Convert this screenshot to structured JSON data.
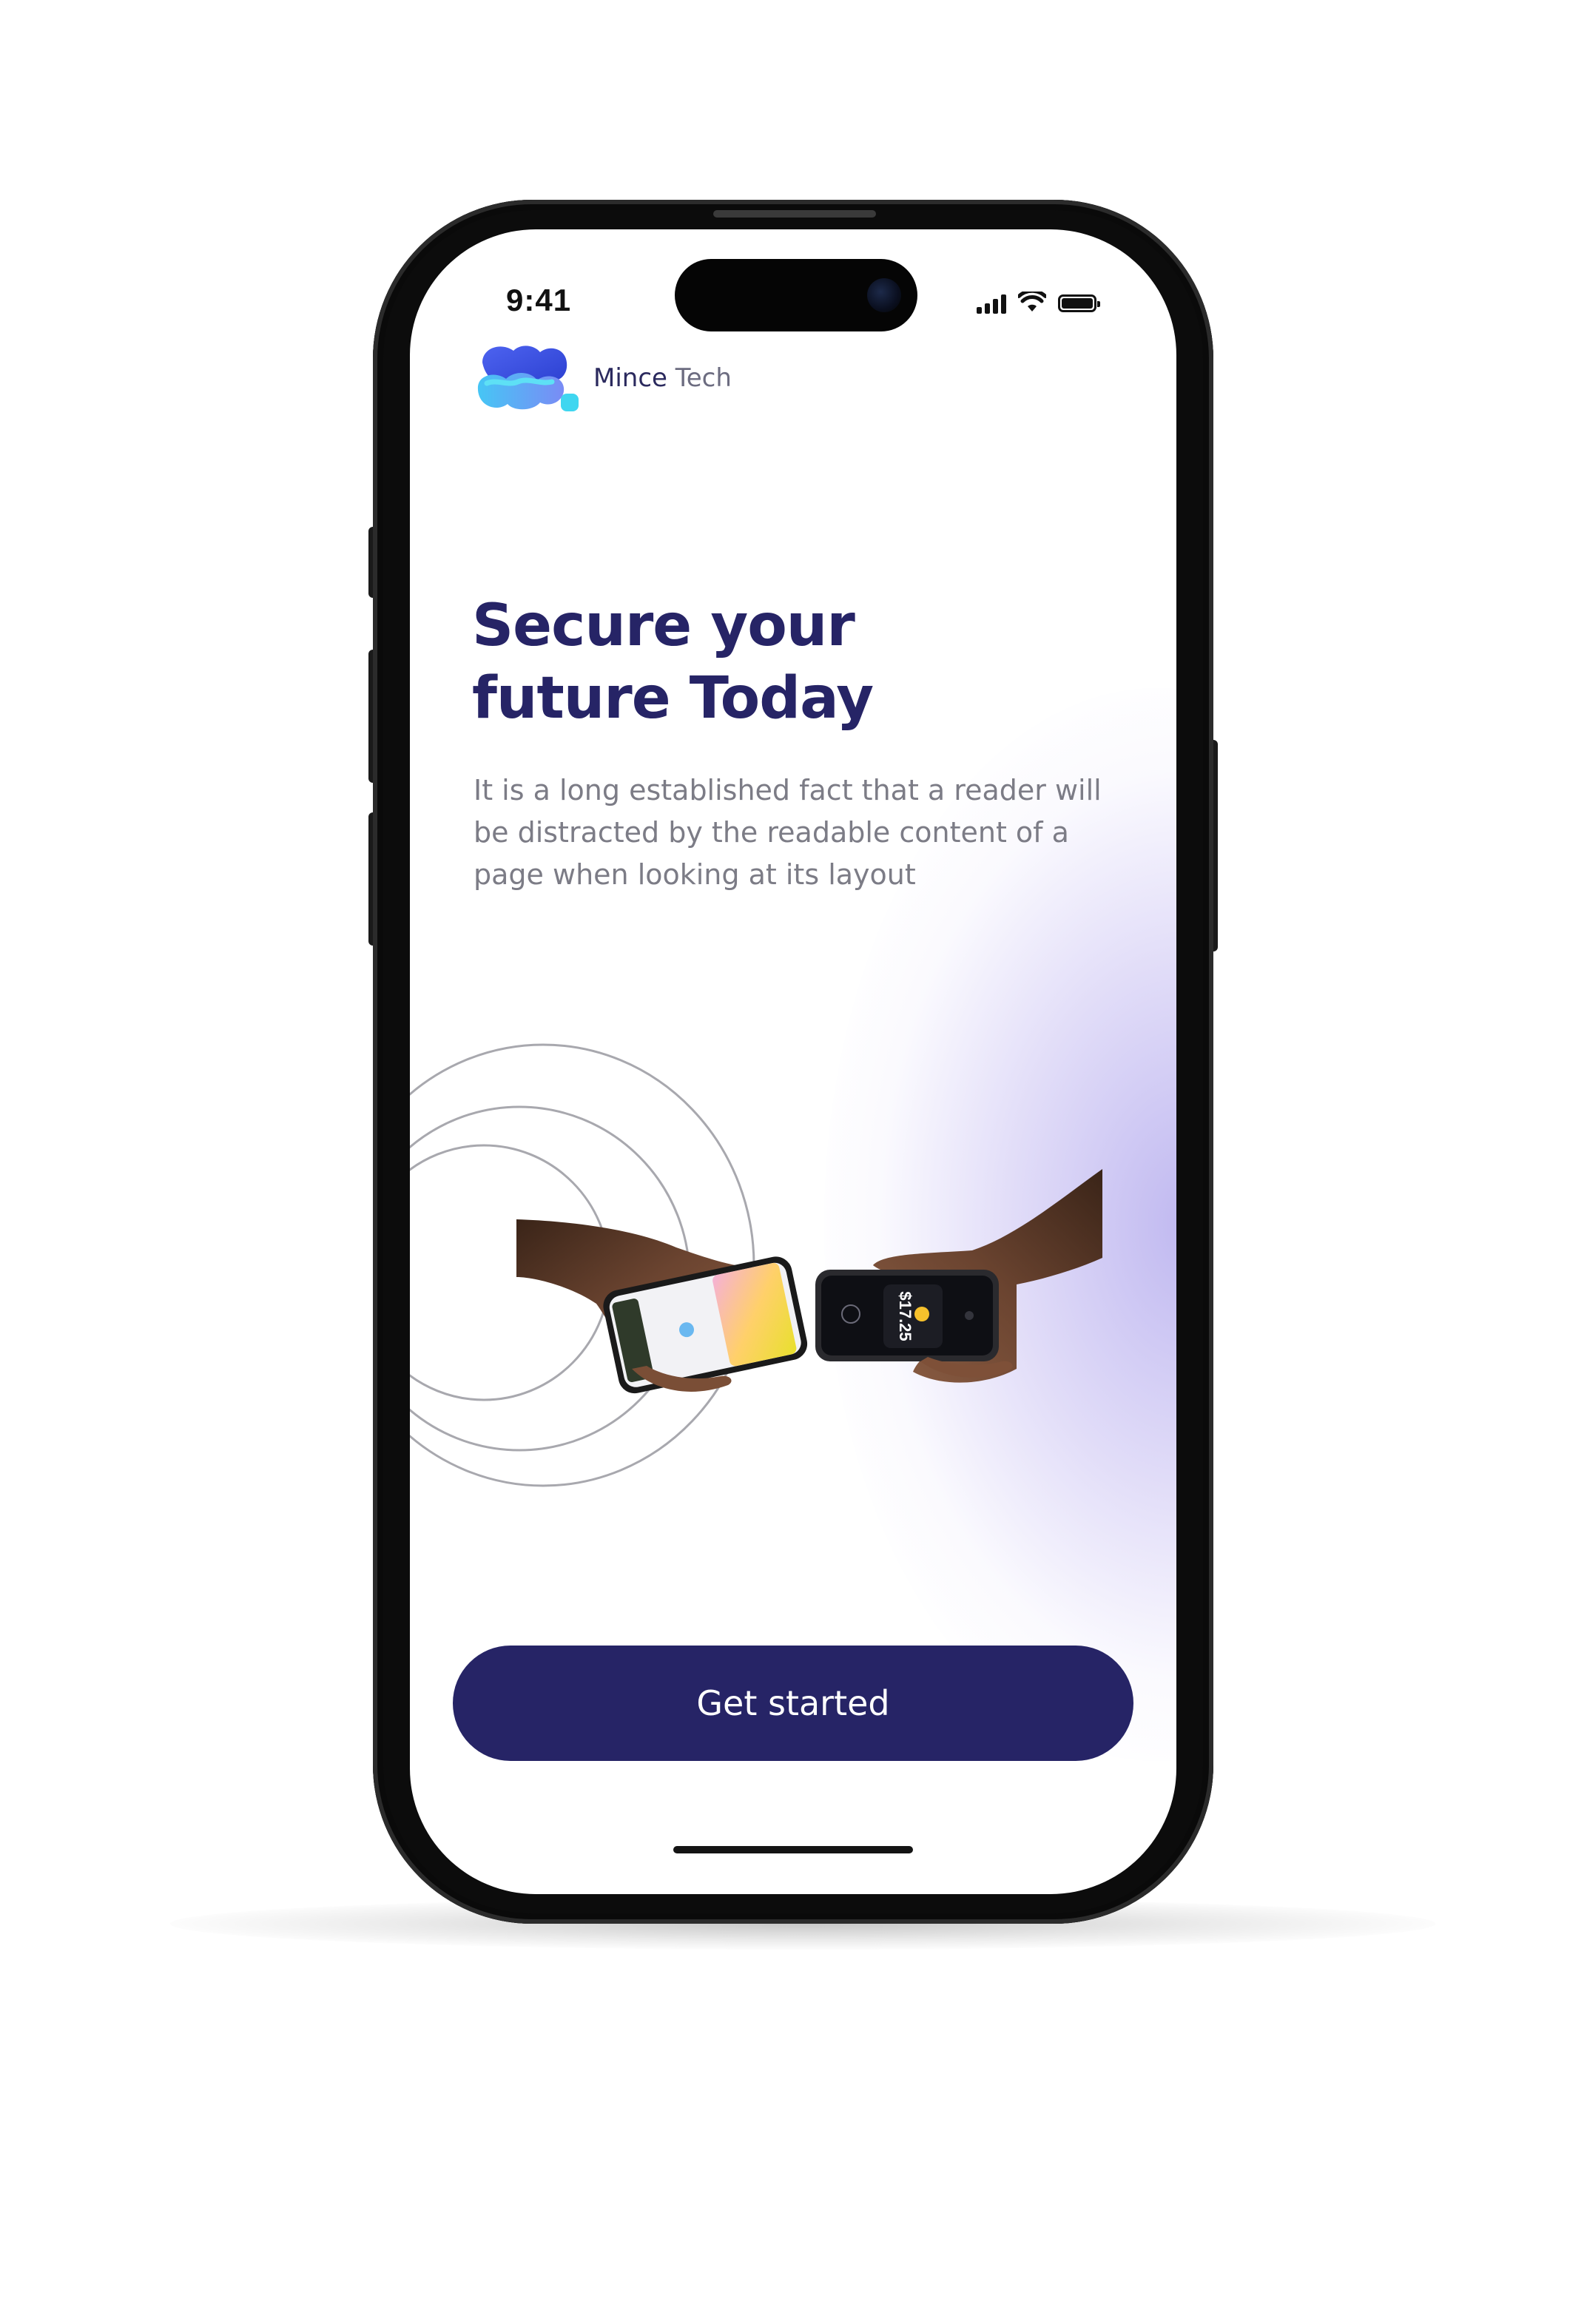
{
  "status_bar": {
    "time": "9:41",
    "icons": [
      "cellular-signal-icon",
      "wifi-icon",
      "battery-icon"
    ]
  },
  "brand": {
    "name_primary": "Mince",
    "name_secondary": "Tech",
    "logo_icon": "wave-cloud-logo"
  },
  "hero": {
    "title_line1": "Secure your",
    "title_line2": "future Today",
    "description": "It is a long established fact that a reader will be distracted by the readable content of a page when looking at its layout"
  },
  "illustration": {
    "payment_amount": "$17.25",
    "icon": "contactless-phone-payment-illustration"
  },
  "cta": {
    "label": "Get started"
  },
  "colors": {
    "primary": "#262466",
    "text_muted": "#7c7c86",
    "glow": "#b4aaf0",
    "logo_blue": "#3b5be8",
    "logo_cyan": "#3fd6f0"
  }
}
